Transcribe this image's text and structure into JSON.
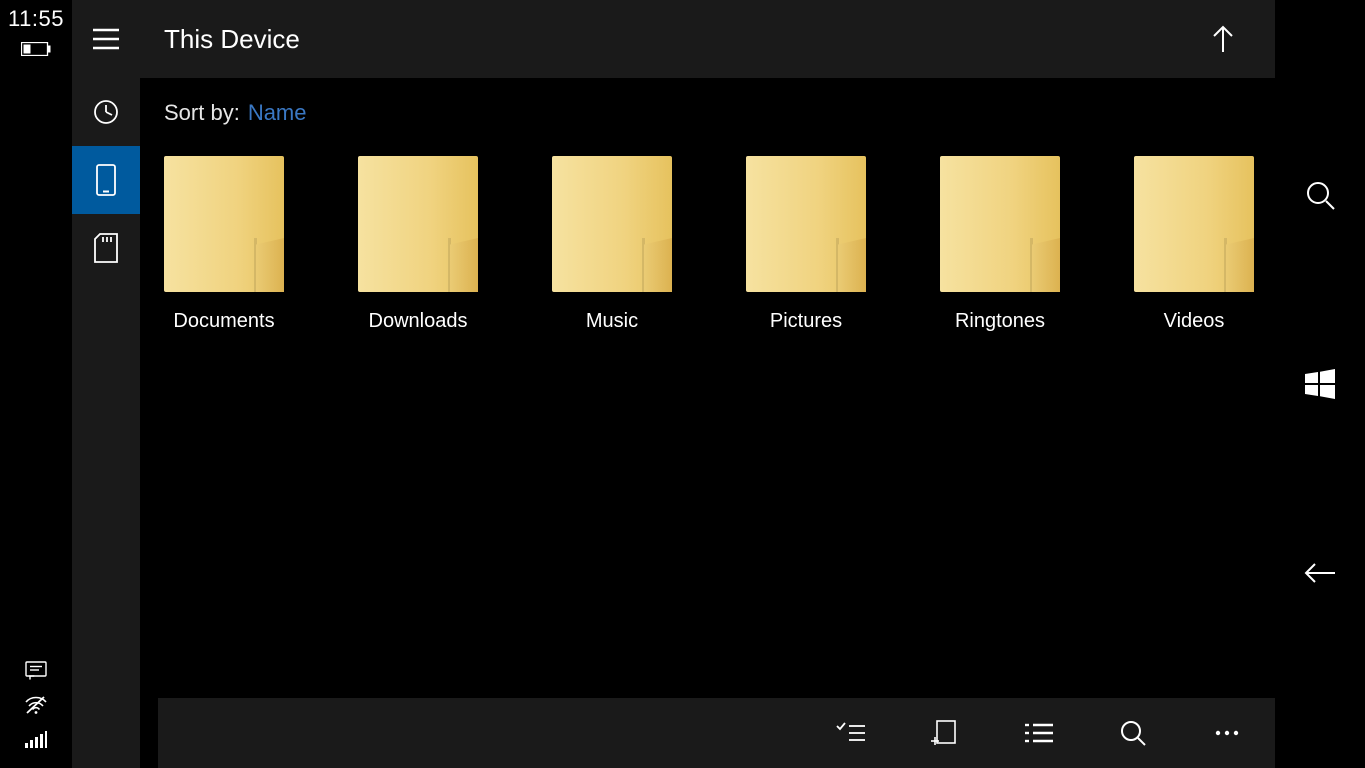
{
  "status": {
    "clock": "11:55"
  },
  "header": {
    "title": "This Device"
  },
  "sort": {
    "label": "Sort by:",
    "value": "Name"
  },
  "folders": [
    {
      "name": "Documents"
    },
    {
      "name": "Downloads"
    },
    {
      "name": "Music"
    },
    {
      "name": "Pictures"
    },
    {
      "name": "Ringtones"
    },
    {
      "name": "Videos"
    }
  ]
}
